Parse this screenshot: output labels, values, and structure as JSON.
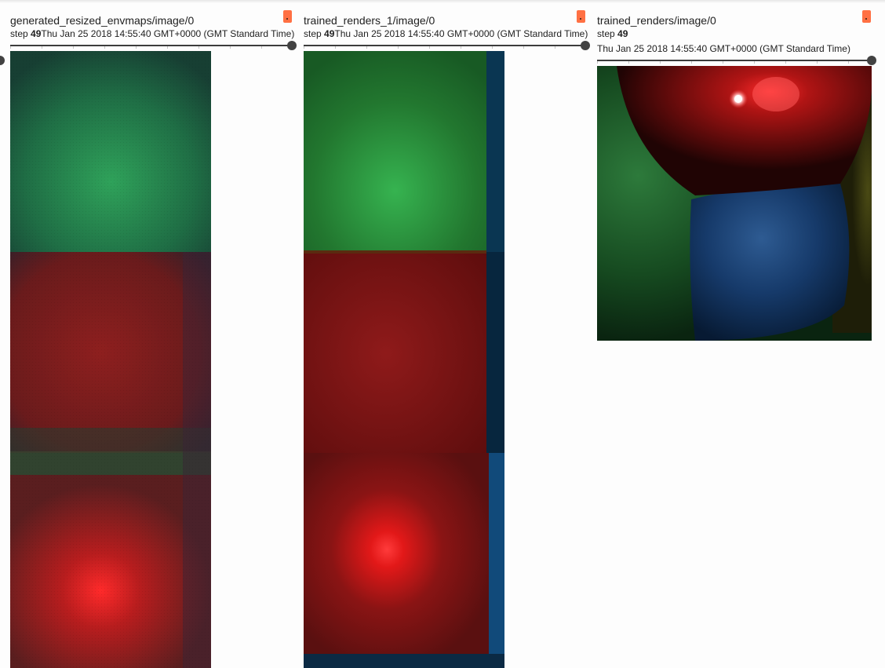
{
  "cards": [
    {
      "tag": "generated_resized_envmaps/image/0",
      "step_label": "step",
      "step_value": "49",
      "timestamp": "Thu Jan 25 2018 14:55:40 GMT+0000 (GMT Standard Time)",
      "expand_icon": "expand-icon",
      "slider_value": 1.0
    },
    {
      "tag": "trained_renders_1/image/0",
      "step_label": "step",
      "step_value": "49",
      "timestamp": "Thu Jan 25 2018 14:55:40 GMT+0000 (GMT Standard Time)",
      "expand_icon": "expand-icon",
      "slider_value": 1.0
    },
    {
      "tag": "trained_renders/image/0",
      "step_label": "step",
      "step_value": "49",
      "timestamp": "Thu Jan 25 2018 14:55:40 GMT+0000 (GMT Standard Time)",
      "expand_icon": "expand-icon",
      "slider_value": 1.0
    }
  ],
  "colors": {
    "accent": "#ff7043",
    "slider": "#424242",
    "text": "#212121"
  }
}
